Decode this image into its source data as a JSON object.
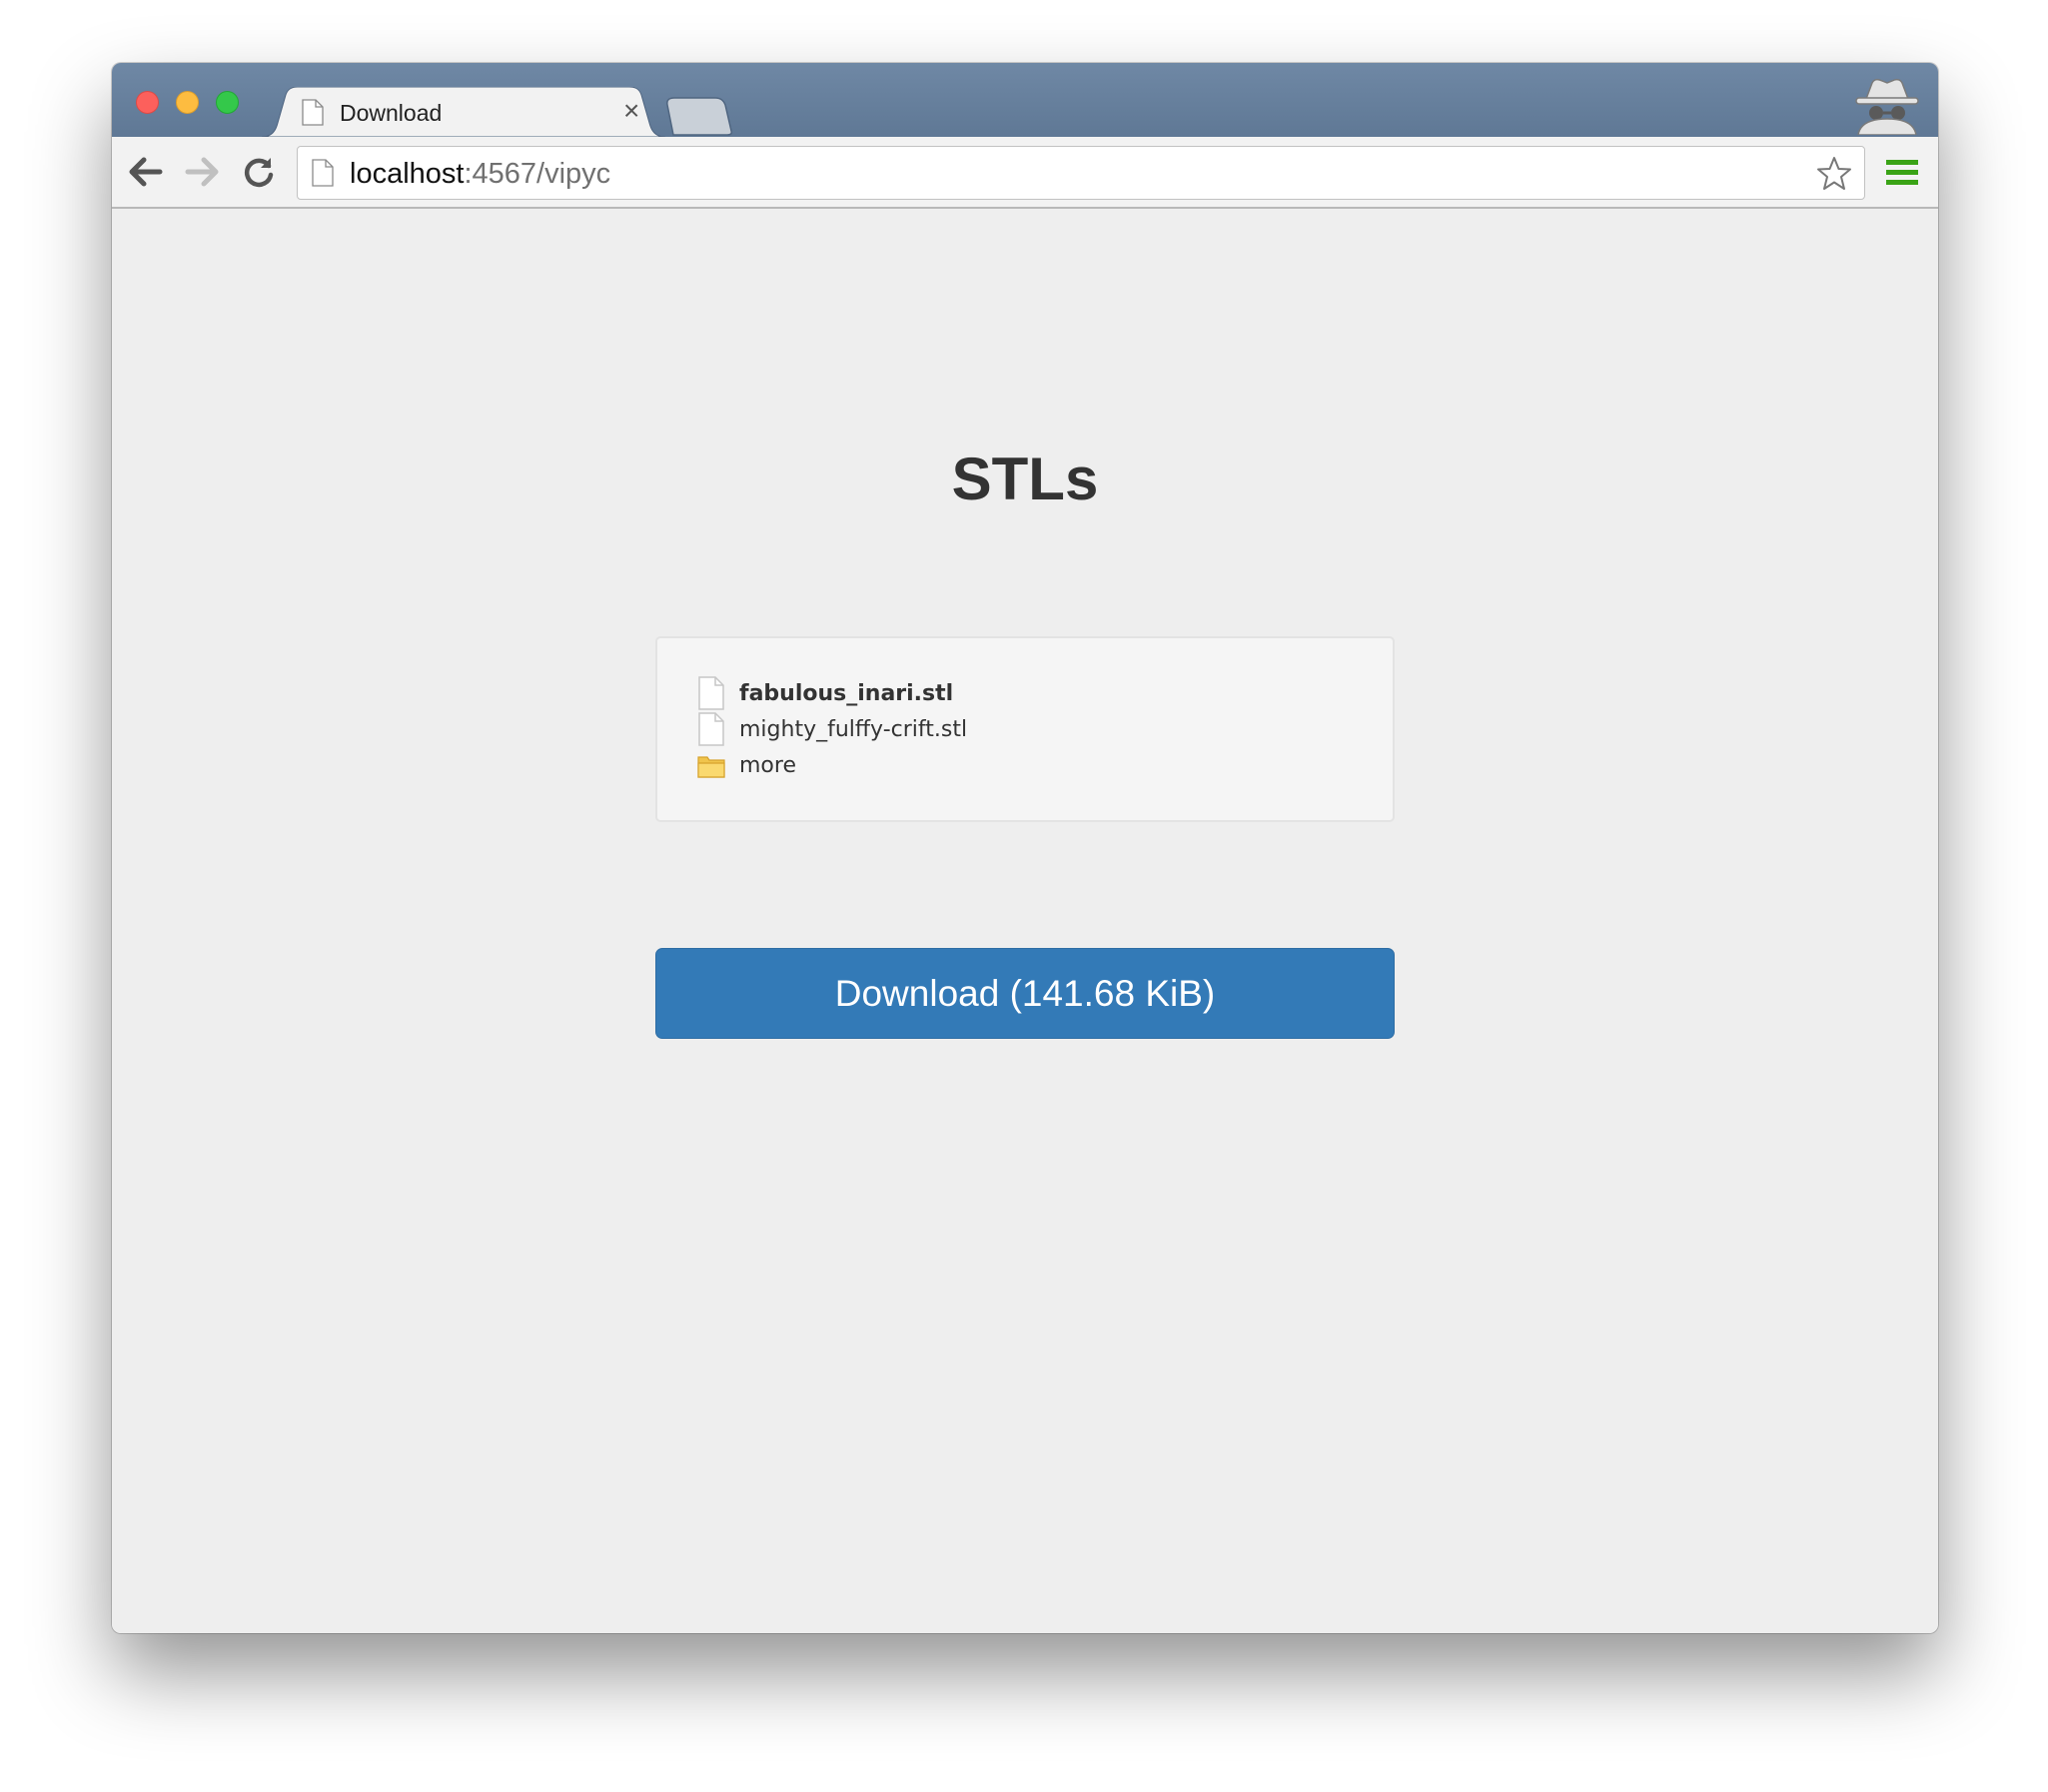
{
  "browser": {
    "tab": {
      "title": "Download",
      "close_glyph": "×"
    },
    "omnibox": {
      "host": "localhost",
      "path": ":4567/vipyc"
    },
    "icons": {
      "back": "back-arrow-icon",
      "forward": "forward-arrow-icon",
      "reload": "reload-icon",
      "bookmark": "star-icon",
      "menu": "hamburger-menu-icon",
      "incognito": "incognito-icon",
      "page": "page-icon"
    },
    "colors": {
      "titlebar": "#6a839f",
      "menu_icon": "#3aa316"
    }
  },
  "page": {
    "heading": "STLs",
    "files": [
      {
        "name": "fabulous_inari.stl",
        "type": "file",
        "bold": true
      },
      {
        "name": "mighty_fulffy-crift.stl",
        "type": "file",
        "bold": false
      },
      {
        "name": "more",
        "type": "folder",
        "bold": false
      }
    ],
    "download_button": "Download (141.68 KiB)",
    "colors": {
      "button": "#337ab7",
      "background": "#eeeeee"
    }
  }
}
